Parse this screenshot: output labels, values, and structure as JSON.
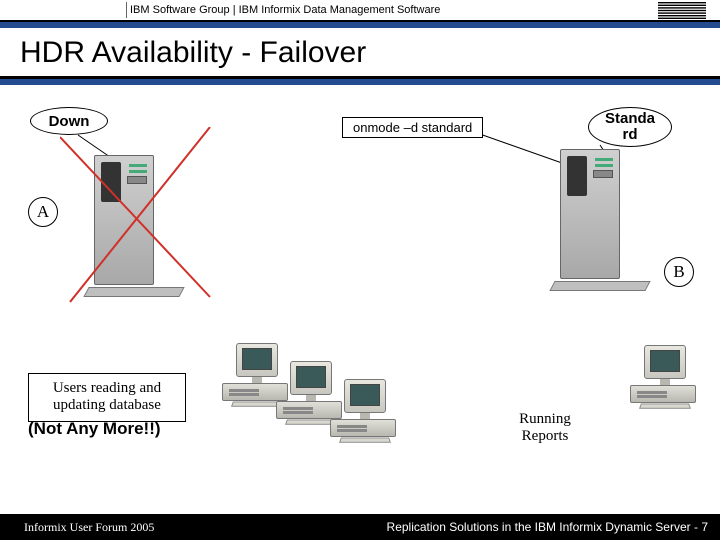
{
  "header": {
    "breadcrumb": "IBM Software Group  |  IBM Informix Data Management Software",
    "logo_alt": "IBM"
  },
  "title": "HDR Availability - Failover",
  "labels": {
    "down": "Down",
    "standard": "Standa\nrd",
    "a": "A",
    "b": "B",
    "command": "onmode –d standard"
  },
  "callouts": {
    "users": "Users reading and updating database",
    "not_any_more": "(Not Any More!!)",
    "reports": "Running Reports"
  },
  "footer": {
    "left": "Informix User Forum 2005",
    "right": "Replication Solutions in the IBM Informix Dynamic Server  -  7"
  }
}
